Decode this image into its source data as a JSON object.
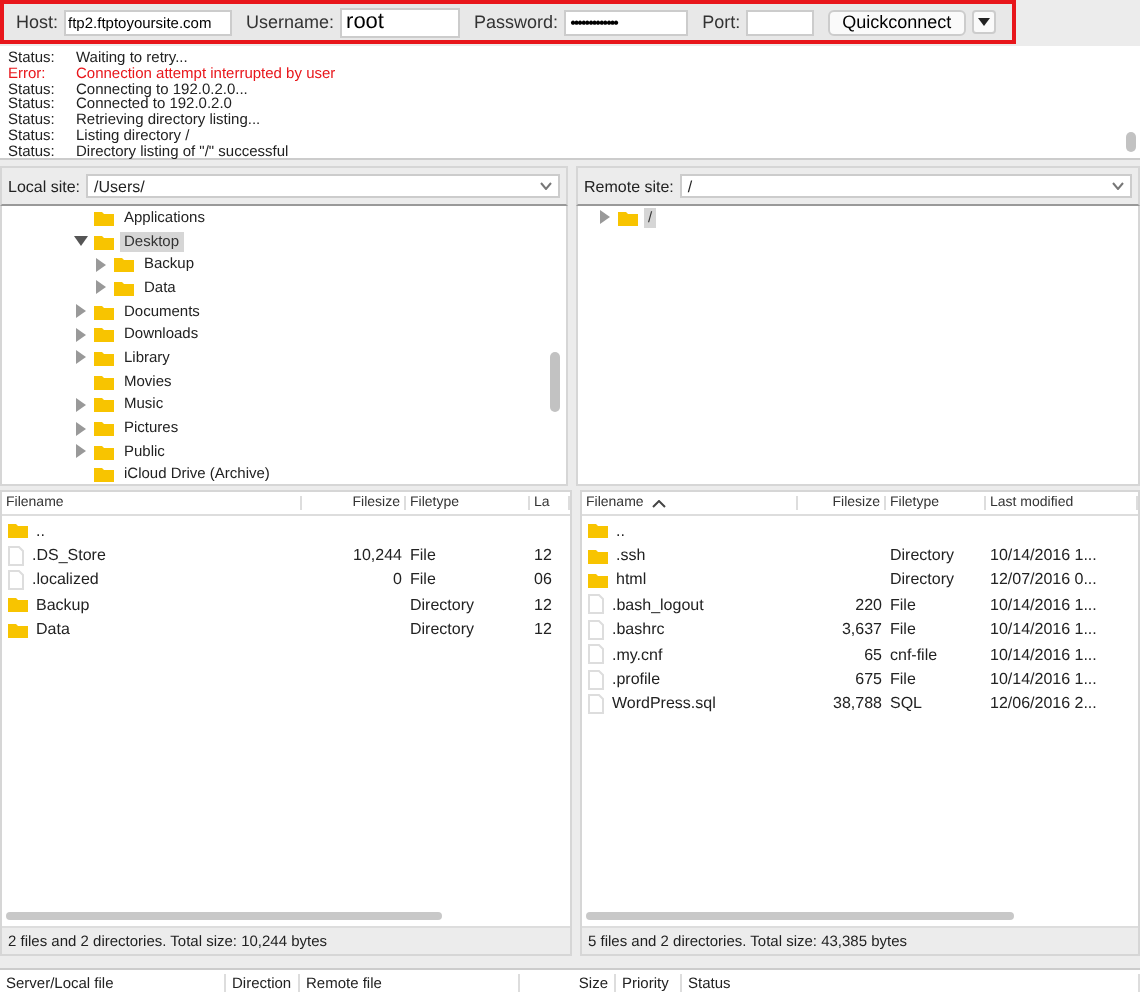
{
  "quickconnect": {
    "host_label": "Host:",
    "host": "ftp2.ftptoyoursite.com",
    "username_label": "Username:",
    "username": "root",
    "password_label": "Password:",
    "password": "•••••••••••••",
    "port_label": "Port:",
    "button": "Quickconnect"
  },
  "log": [
    {
      "kind": "status",
      "label": "Status:",
      "message": "Waiting to retry..."
    },
    {
      "kind": "error",
      "label": "Error:",
      "message": "Connection attempt interrupted by user"
    },
    {
      "kind": "status",
      "label": "Status:",
      "message": "Connecting to 192.0.2.0..."
    },
    {
      "kind": "status",
      "label": "Status:",
      "message": "Connected to 192.0.2.0"
    },
    {
      "kind": "status",
      "label": "Status:",
      "message": "Retrieving directory listing..."
    },
    {
      "kind": "status",
      "label": "Status:",
      "message": "Listing directory /"
    },
    {
      "kind": "status",
      "label": "Status:",
      "message": "Directory listing of \"/\" successful"
    }
  ],
  "local": {
    "site_label": "Local site:",
    "path": "/Users/",
    "tree": [
      {
        "name": "Applications",
        "selected": false
      },
      {
        "name": "Desktop",
        "expanded": true,
        "selected": true,
        "children": [
          {
            "name": "Backup",
            "expanded": false,
            "selected": false
          },
          {
            "name": "Data",
            "expanded": false,
            "selected": false
          }
        ]
      },
      {
        "name": "Documents",
        "expanded": false,
        "selected": false
      },
      {
        "name": "Downloads",
        "expanded": false,
        "selected": false
      },
      {
        "name": "Library",
        "expanded": false,
        "selected": false
      },
      {
        "name": "Movies",
        "selected": false
      },
      {
        "name": "Music",
        "expanded": false,
        "selected": false
      },
      {
        "name": "Pictures",
        "expanded": false,
        "selected": false
      },
      {
        "name": "Public",
        "expanded": false,
        "selected": false
      },
      {
        "name": "iCloud Drive (Archive)",
        "selected": false
      }
    ],
    "columns": [
      "Filename",
      "Filesize",
      "Filetype",
      "La"
    ],
    "rows": [
      {
        "kind": "folder",
        "cells": [
          "..",
          "",
          "",
          ""
        ]
      },
      {
        "kind": "file",
        "cells": [
          ".DS_Store",
          "10,244",
          "File",
          "12"
        ]
      },
      {
        "kind": "file",
        "cells": [
          ".localized",
          "0",
          "File",
          "06"
        ]
      },
      {
        "kind": "folder",
        "cells": [
          "Backup",
          "",
          "Directory",
          "12"
        ]
      },
      {
        "kind": "folder",
        "cells": [
          "Data",
          "",
          "Directory",
          "12"
        ]
      }
    ],
    "status": "2 files and 2 directories. Total size: 10,244 bytes"
  },
  "remote": {
    "site_label": "Remote site:",
    "path": "/",
    "tree": [
      {
        "name": "/",
        "expanded": false,
        "selected": true
      }
    ],
    "columns": [
      "Filename",
      "Filesize",
      "Filetype",
      "Last modified"
    ],
    "rows": [
      {
        "kind": "folder",
        "cells": [
          "..",
          "",
          "",
          ""
        ]
      },
      {
        "kind": "folder",
        "cells": [
          ".ssh",
          "",
          "Directory",
          "10/14/2016 1..."
        ]
      },
      {
        "kind": "folder",
        "cells": [
          "html",
          "",
          "Directory",
          "12/07/2016 0..."
        ]
      },
      {
        "kind": "file",
        "cells": [
          ".bash_logout",
          "220",
          "File",
          "10/14/2016 1..."
        ]
      },
      {
        "kind": "file",
        "cells": [
          ".bashrc",
          "3,637",
          "File",
          "10/14/2016 1..."
        ]
      },
      {
        "kind": "file",
        "cells": [
          ".my.cnf",
          "65",
          "cnf-file",
          "10/14/2016 1..."
        ]
      },
      {
        "kind": "file",
        "cells": [
          ".profile",
          "675",
          "File",
          "10/14/2016 1..."
        ]
      },
      {
        "kind": "file",
        "cells": [
          "WordPress.sql",
          "38,788",
          "SQL",
          "12/06/2016 2..."
        ]
      }
    ],
    "status": "5 files and 2 directories. Total size: 43,385 bytes"
  },
  "queue": {
    "columns": [
      "Server/Local file",
      "Direction",
      "Remote file",
      "Size",
      "Priority",
      "Status"
    ]
  }
}
